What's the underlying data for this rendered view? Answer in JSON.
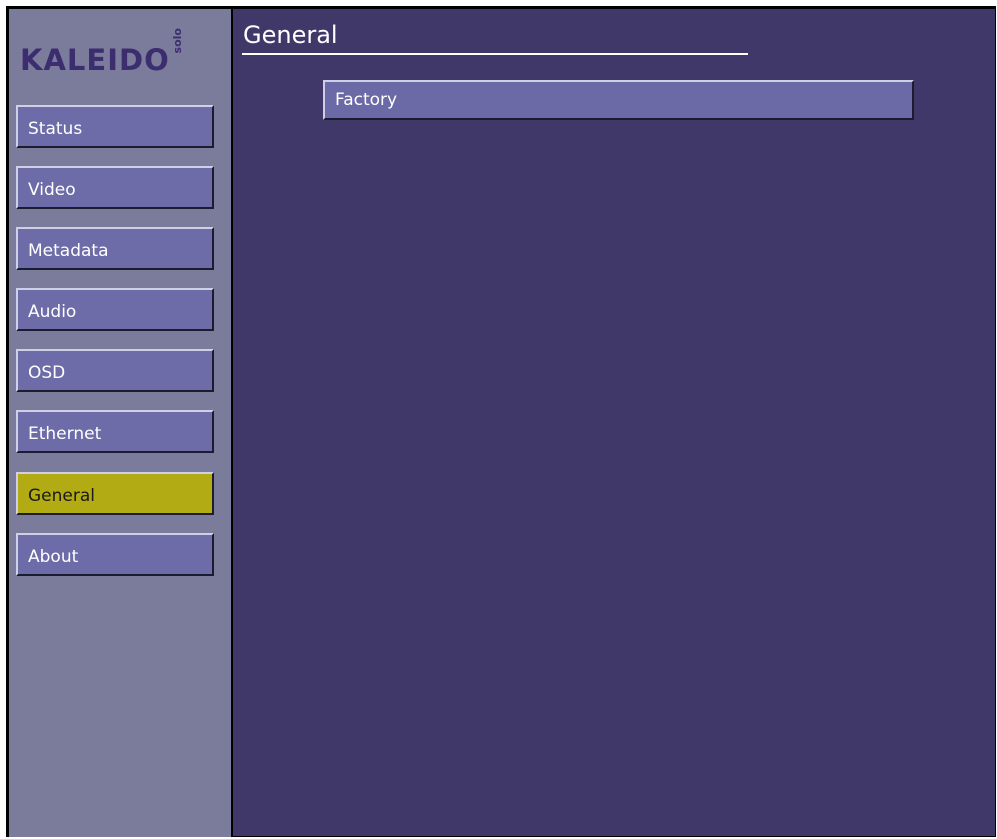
{
  "logo": {
    "main": "KALEIDO",
    "sub": "solo"
  },
  "sidebar": {
    "items": [
      {
        "label": "Status"
      },
      {
        "label": "Video"
      },
      {
        "label": "Metadata"
      },
      {
        "label": "Audio"
      },
      {
        "label": "OSD"
      },
      {
        "label": "Ethernet"
      },
      {
        "label": "General"
      },
      {
        "label": "About"
      }
    ],
    "active": "General"
  },
  "main": {
    "title": "General",
    "buttons": [
      {
        "label": "Factory"
      }
    ]
  },
  "colors": {
    "sidebar_bg": "#7b7c9c",
    "main_bg": "#41386a",
    "button_bg": "#6d6ca8",
    "active_bg": "#b2ab14",
    "logo": "#3b2d6e"
  }
}
